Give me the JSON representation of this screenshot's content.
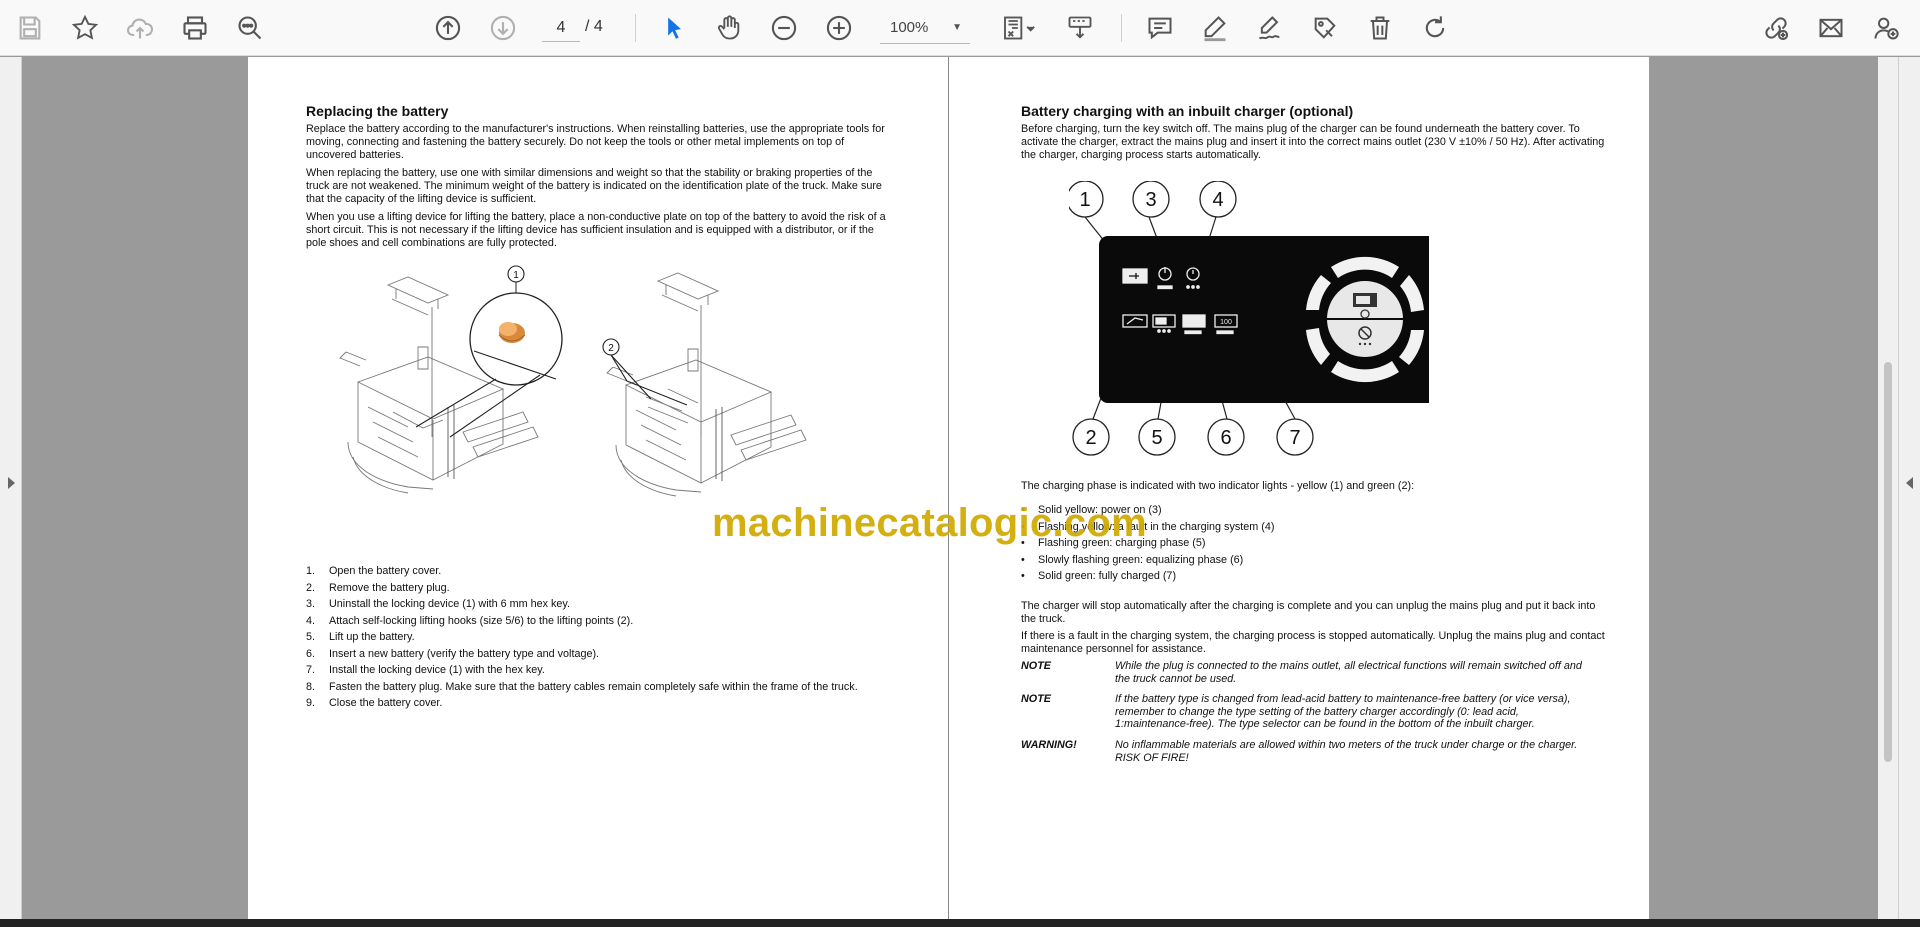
{
  "toolbar": {
    "current_page": "4",
    "page_total": "/ 4",
    "zoom": "100%",
    "icons": [
      "save-icon",
      "bookmark-star-icon",
      "cloud-upload-icon",
      "print-icon",
      "search-zoom-icon",
      "page-up-icon",
      "page-down-icon",
      "select-cursor-icon",
      "hand-tool-icon",
      "zoom-out-icon",
      "zoom-in-icon",
      "fit-page-icon",
      "scroll-mode-icon",
      "comment-icon",
      "highlight-pen-icon",
      "signature-icon",
      "stamp-icon",
      "delete-icon",
      "rotate-icon",
      "share-link-icon",
      "email-icon",
      "add-user-icon"
    ],
    "accent_color": "#1473e6"
  },
  "left_page": {
    "title": "Replacing the battery",
    "paragraphs": [
      "Replace the battery according to the manufacturer's instructions. When reinstalling batteries, use the appropriate tools for moving, connecting and fastening the battery securely. Do not keep the tools or other metal implements on top of uncovered batteries.",
      "When replacing the battery, use one with similar dimensions and weight so that the stability or braking properties of the truck are not weakened. The minimum weight of the battery is indicated on the identification plate of the truck. Make sure that the capacity of the lifting device is sufficient.",
      "When you use a lifting device for lifting the battery, place a non-conductive plate on top of the battery to avoid the risk of a short circuit. This is not necessary if the lifting device has sufficient insulation and is equipped with a distributor, or if the pole shoes and cell combinations are fully protected."
    ],
    "figure_callouts": [
      "1",
      "2"
    ],
    "steps": [
      {
        "num": "1.",
        "text": "Open the battery cover."
      },
      {
        "num": "2.",
        "text": "Remove the battery plug."
      },
      {
        "num": "3.",
        "text": "Uninstall the locking device (1) with 6 mm hex key."
      },
      {
        "num": "4.",
        "text": "Attach self-locking lifting hooks (size 5/6) to the lifting points (2)."
      },
      {
        "num": "5.",
        "text": "Lift up the battery."
      },
      {
        "num": "6.",
        "text": "Insert a new battery (verify the battery type and voltage)."
      },
      {
        "num": "7.",
        "text": "Install the locking device (1) with the hex key."
      },
      {
        "num": "8.",
        "text": "Fasten the battery plug. Make sure that the battery cables remain completely safe within the frame of the truck."
      },
      {
        "num": "9.",
        "text": "Close the battery cover."
      }
    ]
  },
  "right_page": {
    "title": "Battery charging with an inbuilt charger (optional)",
    "intro": "Before charging, turn the key switch off. The mains plug of the charger can be found underneath the battery cover. To activate the charger, extract the mains plug and insert it into the correct mains outlet (230 V ±10% / 50 Hz). After activating the charger, charging process starts automatically.",
    "panel_callouts": [
      "1",
      "3",
      "4",
      "2",
      "5",
      "6",
      "7"
    ],
    "charging_phase_intro": "The charging phase is indicated with two indicator lights - yellow (1) and green (2):",
    "bullets": [
      "Solid yellow: power on (3)",
      "Flashing yellow: a fault in the charging system (4)",
      "Flashing green: charging phase (5)",
      "Slowly flashing green: equalizing phase (6)",
      "Solid green: fully charged (7)"
    ],
    "para_after_1": "The charger will stop automatically after the charging is complete and you can unplug the mains plug and put it back into the truck.",
    "para_after_2": "If there is a fault in the charging system, the charging process is stopped automatically. Unplug the mains plug and contact maintenance personnel for assistance.",
    "notes": [
      {
        "label": "NOTE",
        "text": "While the plug is connected to the mains outlet, all electrical functions will remain switched off and the truck cannot be used."
      },
      {
        "label": "NOTE",
        "text": "If the battery type is changed from lead-acid battery to maintenance-free battery (or vice versa), remember to change the type setting of the battery charger accordingly (0: lead acid, 1:maintenance-free). The type selector can be found in the bottom of the inbuilt charger."
      },
      {
        "label": "WARNING!",
        "text": "No inflammable materials are allowed within two meters of the truck under charge or the charger. RISK OF FIRE!"
      }
    ]
  },
  "watermark": "machinecatalogic.com"
}
